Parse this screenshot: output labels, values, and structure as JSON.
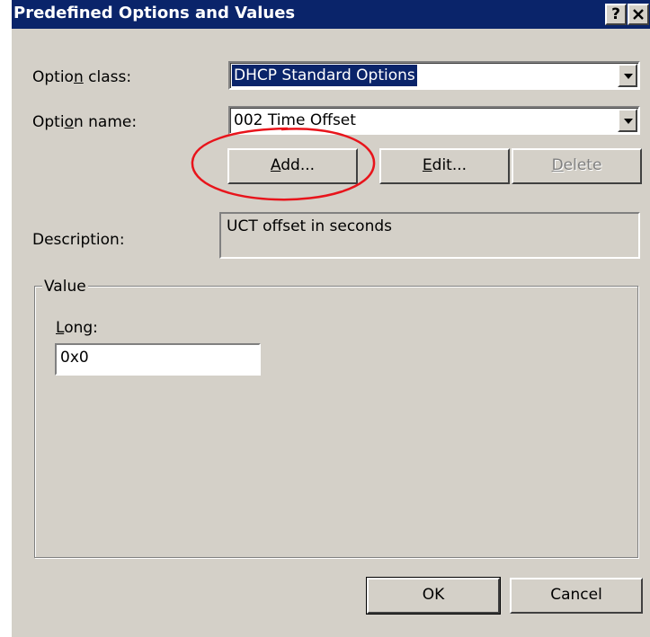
{
  "window": {
    "title": "Predefined Options and Values",
    "help_button": "?",
    "close_button": "✕"
  },
  "option_class": {
    "label": "Option class:",
    "value": "DHCP Standard Options"
  },
  "option_name": {
    "label": "Option name:",
    "value": "002 Time Offset"
  },
  "buttons": {
    "add": "Add...",
    "edit": "Edit...",
    "delete": "Delete",
    "ok": "OK",
    "cancel": "Cancel"
  },
  "description": {
    "label": "Description:",
    "value": "UCT offset in seconds"
  },
  "value_group": {
    "legend": "Value",
    "long_label": "Long:",
    "long_value": "0x0"
  },
  "annotation": {
    "color": "#e8141b",
    "target": "add-button"
  },
  "colors": {
    "titlebar": "#0a246a",
    "dialog_face": "#d4d0c8",
    "selection": "#0a246a"
  }
}
